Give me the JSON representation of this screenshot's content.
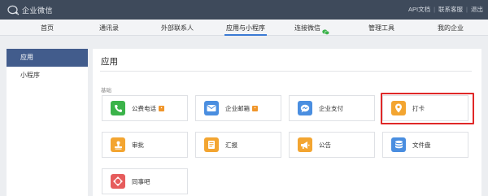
{
  "app": {
    "name": "企业微信"
  },
  "top_links": [
    "API文档",
    "联系客服",
    "退出"
  ],
  "nav": {
    "items": [
      {
        "label": "首页"
      },
      {
        "label": "通讯录"
      },
      {
        "label": "外部联系人"
      },
      {
        "label": "应用与小程序",
        "active": true
      },
      {
        "label": "连接微信"
      },
      {
        "label": "管理工具"
      },
      {
        "label": "我的企业"
      }
    ]
  },
  "sidebar": {
    "items": [
      {
        "label": "应用",
        "active": true
      },
      {
        "label": "小程序"
      }
    ]
  },
  "main": {
    "title": "应用",
    "section_label": "基础",
    "apps": [
      {
        "label": "公费电话",
        "icon": "phone-icon",
        "color": "#3bb34a",
        "badge": true
      },
      {
        "label": "企业邮箱",
        "icon": "mail-icon",
        "color": "#4a8ee0",
        "badge": true
      },
      {
        "label": "企业支付",
        "icon": "payment-icon",
        "color": "#4a8ee0"
      },
      {
        "label": "打卡",
        "icon": "location-pin-icon",
        "color": "#f3a531",
        "highlighted": true
      },
      {
        "label": "审批",
        "icon": "stamp-icon",
        "color": "#f3a531"
      },
      {
        "label": "汇报",
        "icon": "report-icon",
        "color": "#f3a531"
      },
      {
        "label": "公告",
        "icon": "megaphone-icon",
        "color": "#f3a531"
      },
      {
        "label": "文件盘",
        "icon": "drive-icon",
        "color": "#4a8ee0"
      },
      {
        "label": "同事吧",
        "icon": "community-icon",
        "color": "#e65c5c"
      }
    ]
  },
  "colors": {
    "topbar": "#3e4a5b",
    "sidebar_active": "#425c8c",
    "nav_underline": "#3a7ad4",
    "highlight_border": "#e02828",
    "badge": "#f0962b"
  }
}
